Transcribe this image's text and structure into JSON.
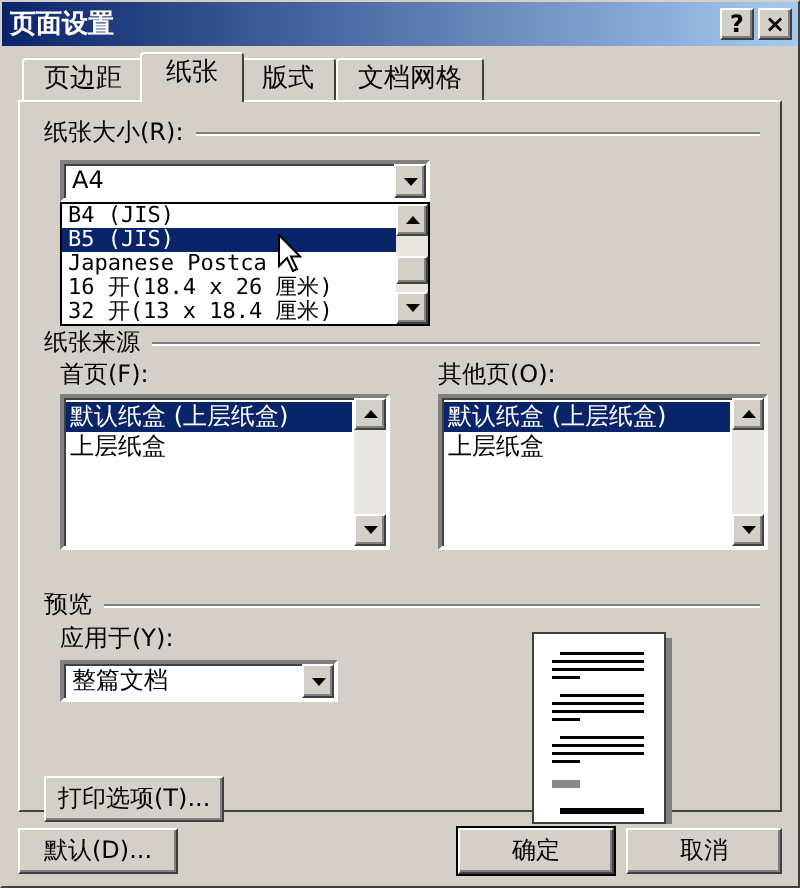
{
  "window": {
    "title": "页面设置",
    "help_button": "?",
    "close_button": "×"
  },
  "tabs": [
    {
      "label": "页边距",
      "selected": false
    },
    {
      "label": "纸张",
      "selected": true
    },
    {
      "label": "版式",
      "selected": false
    },
    {
      "label": "文档网格",
      "selected": false
    }
  ],
  "paper_size": {
    "label": "纸张大小(R):",
    "value": "A4",
    "dropdown_items": [
      {
        "label": "B4 (JIS)",
        "selected": false
      },
      {
        "label": "B5 (JIS)",
        "selected": true
      },
      {
        "label": "Japanese Postca",
        "selected": false
      },
      {
        "label": "16 开(18.4 x 26 厘米)",
        "selected": false
      },
      {
        "label": "32 开(13 x 18.4 厘米)",
        "selected": false
      }
    ]
  },
  "paper_source": {
    "label": "纸张来源",
    "first_page": {
      "label": "首页(F):",
      "items": [
        {
          "label": "默认纸盒 (上层纸盒)",
          "selected": true
        },
        {
          "label": "上层纸盒",
          "selected": false
        }
      ]
    },
    "other_pages": {
      "label": "其他页(O):",
      "items": [
        {
          "label": "默认纸盒 (上层纸盒)",
          "selected": true
        },
        {
          "label": "上层纸盒",
          "selected": false
        }
      ]
    }
  },
  "preview": {
    "label": "预览",
    "apply_to": {
      "label": "应用于(Y):",
      "value": "整篇文档"
    },
    "print_options_button": "打印选项(T)..."
  },
  "footer_buttons": [
    "默认(D)...",
    "确定",
    "取消"
  ]
}
